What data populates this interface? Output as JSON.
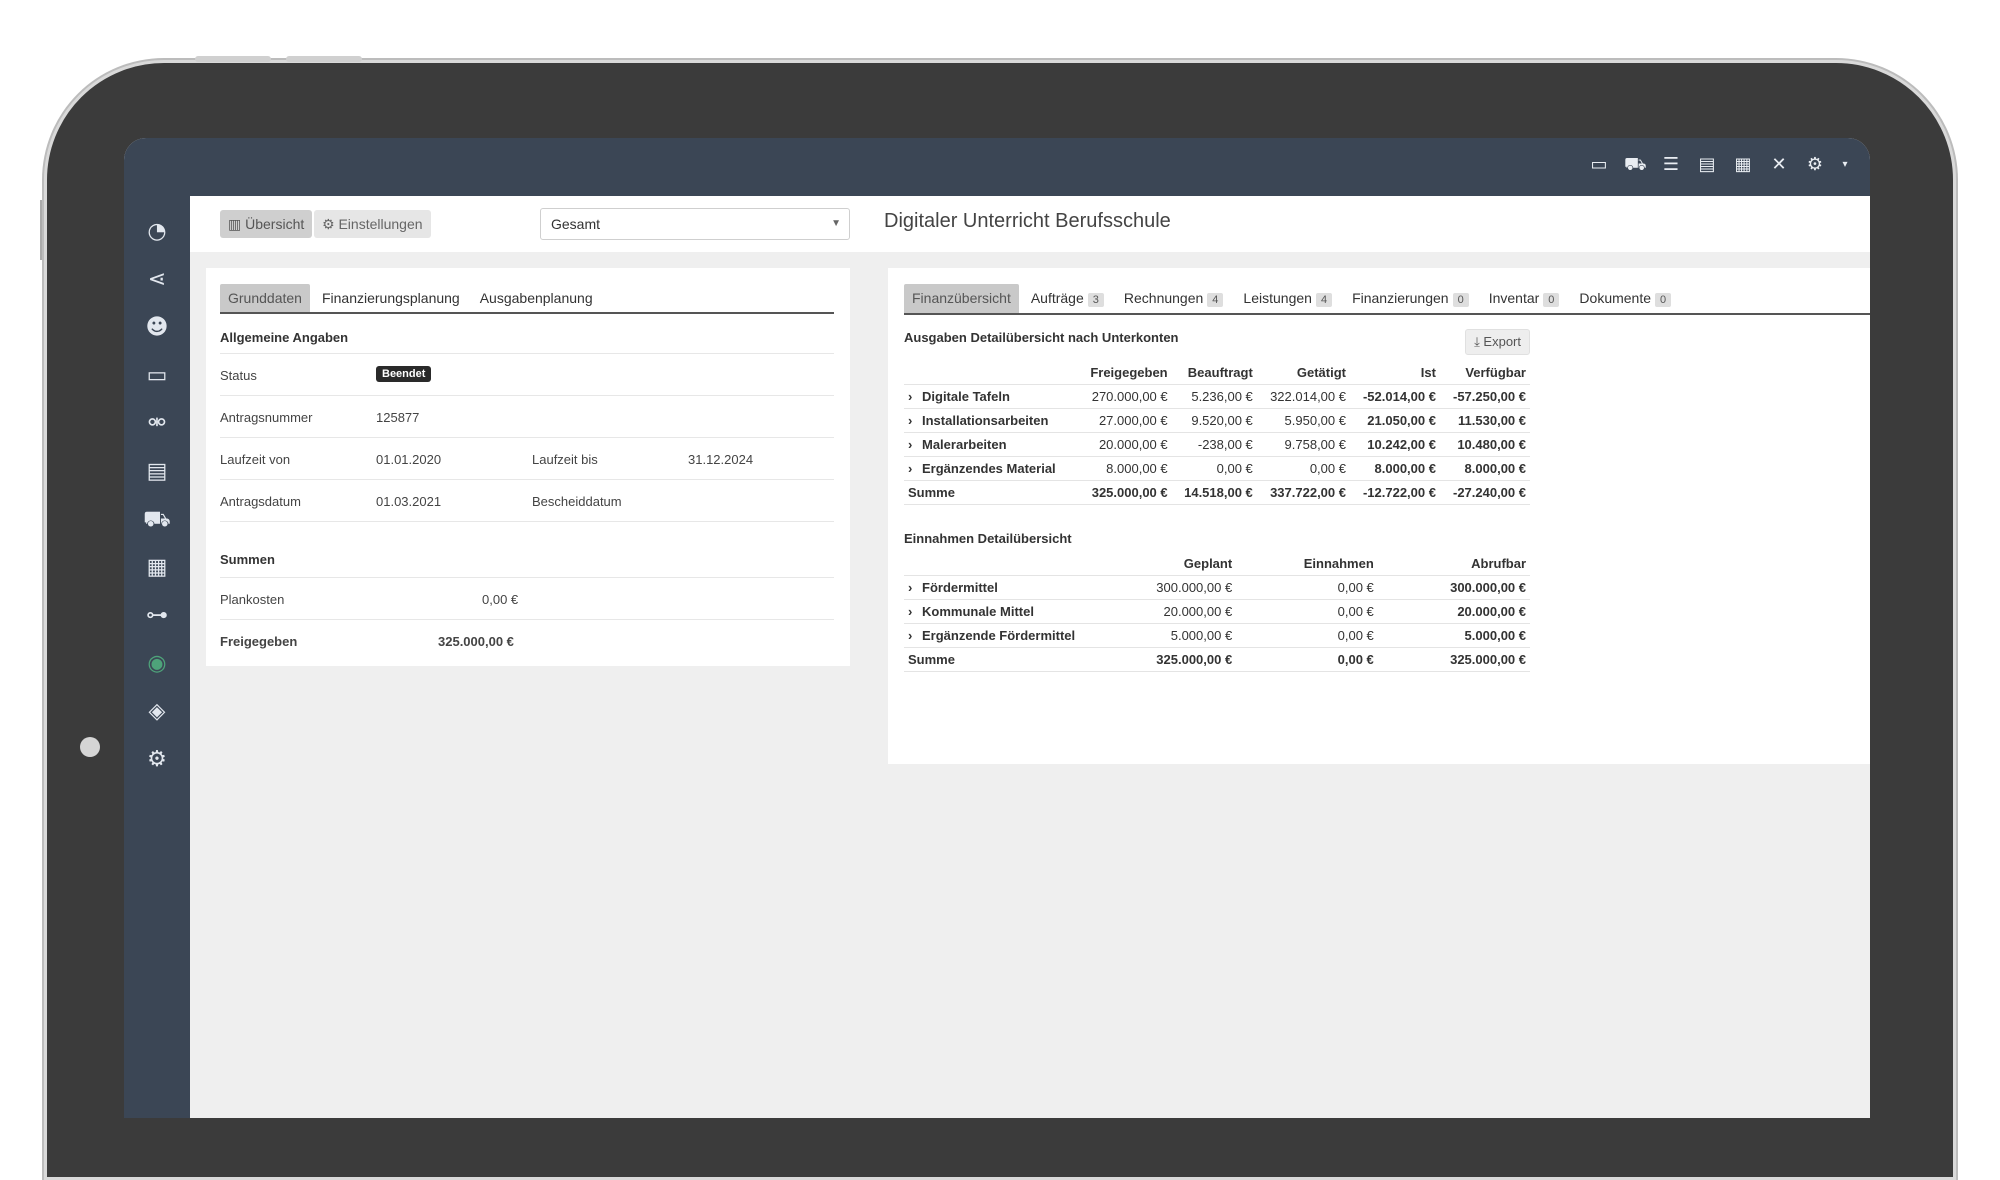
{
  "topbar": {
    "icons": [
      "calendar-icon",
      "toolbox-icon",
      "checklist-icon",
      "clipboard-icon",
      "document-icon",
      "tools-icon",
      "gears-icon"
    ]
  },
  "sidebar": {
    "icons": [
      "dashboard-icon",
      "share-icon",
      "users-icon",
      "monitor-icon",
      "handshake-icon",
      "receipt-icon",
      "cart-icon",
      "boxes-icon",
      "sitemap-icon",
      "money-icon",
      "shield-icon",
      "settings-icon"
    ]
  },
  "header": {
    "btn_overview": "Übersicht",
    "btn_settings": "Einstellungen",
    "select_value": "Gesamt",
    "title": "Digitaler Unterricht Berufsschule"
  },
  "left": {
    "tabs": [
      "Grunddaten",
      "Finanzierungsplanung",
      "Ausgabenplanung"
    ],
    "general_title": "Allgemeine Angaben",
    "status_label": "Status",
    "status_value": "Beendet",
    "antragsnummer_label": "Antragsnummer",
    "antragsnummer_value": "125877",
    "laufzeit_von_label": "Laufzeit von",
    "laufzeit_von_value": "01.01.2020",
    "laufzeit_bis_label": "Laufzeit bis",
    "laufzeit_bis_value": "31.12.2024",
    "antragsdatum_label": "Antragsdatum",
    "antragsdatum_value": "01.03.2021",
    "bescheiddatum_label": "Bescheiddatum",
    "summen_title": "Summen",
    "plankosten_label": "Plankosten",
    "plankosten_value": "0,00 €",
    "freigegeben_label": "Freigegeben",
    "freigegeben_value": "325.000,00 €"
  },
  "right": {
    "tabs": [
      {
        "label": "Finanzübersicht",
        "count": ""
      },
      {
        "label": "Aufträge",
        "count": "3"
      },
      {
        "label": "Rechnungen",
        "count": "4"
      },
      {
        "label": "Leistungen",
        "count": "4"
      },
      {
        "label": "Finanzierungen",
        "count": "0"
      },
      {
        "label": "Inventar",
        "count": "0"
      },
      {
        "label": "Dokumente",
        "count": "0"
      }
    ],
    "expenses_title": "Ausgaben Detailübersicht nach Unterkonten",
    "export_label": "Export",
    "expenses_headers": [
      "Freigegeben",
      "Beauftragt",
      "Getätigt",
      "Ist",
      "Verfügbar"
    ],
    "expenses_rows": [
      {
        "label": "Digitale Tafeln",
        "v": [
          "270.000,00 €",
          "5.236,00 €",
          "322.014,00 €",
          "-52.014,00 €",
          "-57.250,00 €"
        ],
        "tone": [
          "",
          "",
          "",
          "neg",
          "neg"
        ]
      },
      {
        "label": "Installationsarbeiten",
        "v": [
          "27.000,00 €",
          "9.520,00 €",
          "5.950,00 €",
          "21.050,00 €",
          "11.530,00 €"
        ],
        "tone": [
          "",
          "",
          "",
          "pos",
          "pos"
        ]
      },
      {
        "label": "Malerarbeiten",
        "v": [
          "20.000,00 €",
          "-238,00 €",
          "9.758,00 €",
          "10.242,00 €",
          "10.480,00 €"
        ],
        "tone": [
          "",
          "",
          "",
          "pos",
          "pos"
        ]
      },
      {
        "label": "Ergänzendes Material",
        "v": [
          "8.000,00 €",
          "0,00 €",
          "0,00 €",
          "8.000,00 €",
          "8.000,00 €"
        ],
        "tone": [
          "",
          "",
          "",
          "pos",
          "pos"
        ]
      }
    ],
    "expenses_sum": {
      "label": "Summe",
      "v": [
        "325.000,00 €",
        "14.518,00 €",
        "337.722,00 €",
        "-12.722,00 €",
        "-27.240,00 €"
      ],
      "tone": [
        "",
        "",
        "",
        "neg",
        "neg"
      ]
    },
    "income_title": "Einnahmen Detailübersicht",
    "income_headers": [
      "Geplant",
      "Einnahmen",
      "Abrufbar"
    ],
    "income_rows": [
      {
        "label": "Fördermittel",
        "v": [
          "300.000,00 €",
          "0,00 €",
          "300.000,00 €"
        ]
      },
      {
        "label": "Kommunale Mittel",
        "v": [
          "20.000,00 €",
          "0,00 €",
          "20.000,00 €"
        ]
      },
      {
        "label": "Ergänzende Fördermittel",
        "v": [
          "5.000,00 €",
          "0,00 €",
          "5.000,00 €"
        ]
      }
    ],
    "income_sum": {
      "label": "Summe",
      "v": [
        "325.000,00 €",
        "0,00 €",
        "325.000,00 €"
      ]
    }
  }
}
